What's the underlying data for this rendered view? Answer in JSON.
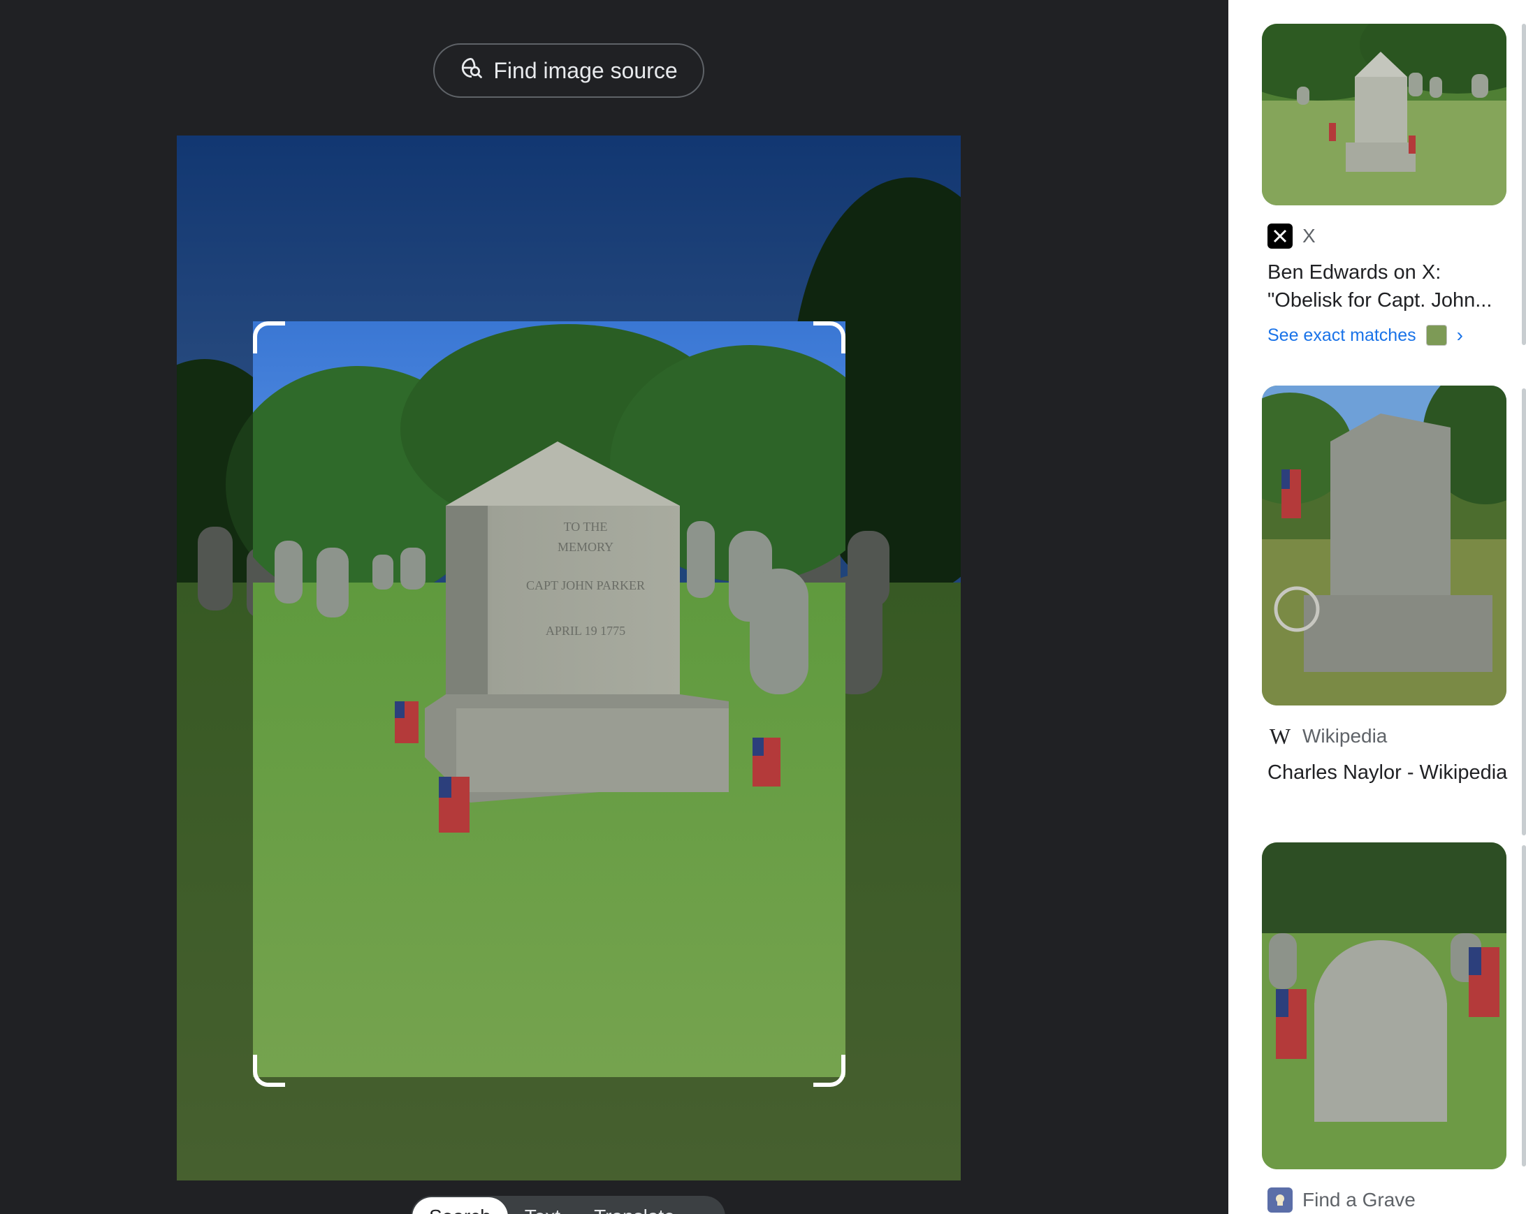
{
  "left": {
    "find_source_label": "Find image source",
    "mode_tabs": [
      "Search",
      "Text",
      "Translate"
    ]
  },
  "results": [
    {
      "source": "X",
      "title": "Ben Edwards on X: \"Obelisk for Capt. John...",
      "exact_label": "See exact matches",
      "icon": "x-logo-icon"
    },
    {
      "source": "Wikipedia",
      "title": "Charles Naylor - Wikipedia",
      "icon": "wikipedia-icon"
    },
    {
      "source": "Find a Grave",
      "icon": "find-a-grave-icon"
    }
  ],
  "colors": {
    "background": "#202124",
    "link": "#1a73e8",
    "panel": "#ffffff"
  }
}
